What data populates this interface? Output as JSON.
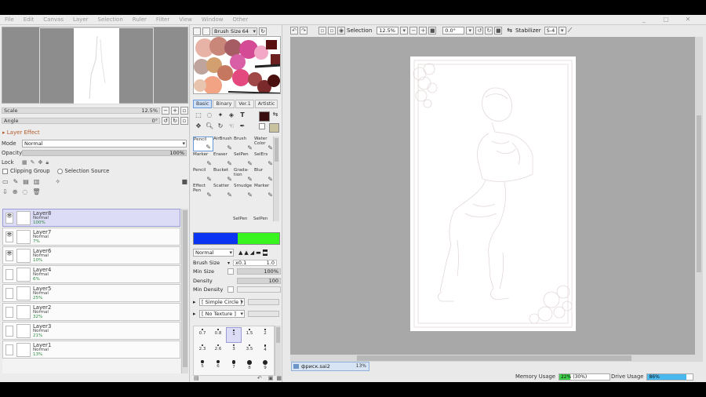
{
  "menu": [
    "File",
    "Edit",
    "Canvas",
    "Layer",
    "Selection",
    "Ruler",
    "Filter",
    "View",
    "Window",
    "Other"
  ],
  "window_controls": [
    "_",
    "▢",
    "✕"
  ],
  "navigator": {
    "scale_label": "Scale",
    "scale_value": "12.5%",
    "angle_label": "Angle",
    "angle_value": "0°"
  },
  "layer_effect": {
    "title": "Layer Effect",
    "mode_label": "Mode",
    "mode_value": "Normal",
    "opacity_label": "Opacity",
    "opacity_value": "100%",
    "lock_label": "Lock",
    "clipping_label": "Clipping Group",
    "selection_source_label": "Selection Source"
  },
  "layers": [
    {
      "name": "Layer8",
      "mode": "Normal",
      "opacity": "100%",
      "visible": true,
      "selected": true
    },
    {
      "name": "Layer7",
      "mode": "Normal",
      "opacity": "7%",
      "visible": true,
      "selected": false
    },
    {
      "name": "Layer6",
      "mode": "Normal",
      "opacity": "10%",
      "visible": true,
      "selected": false
    },
    {
      "name": "Layer4",
      "mode": "Normal",
      "opacity": "6%",
      "visible": false,
      "selected": false
    },
    {
      "name": "Layer5",
      "mode": "Normal",
      "opacity": "25%",
      "visible": false,
      "selected": false
    },
    {
      "name": "Layer2",
      "mode": "Normal",
      "opacity": "32%",
      "visible": false,
      "selected": false
    },
    {
      "name": "Layer3",
      "mode": "Normal",
      "opacity": "21%",
      "visible": false,
      "selected": false
    },
    {
      "name": "Layer1",
      "mode": "Normal",
      "opacity": "13%",
      "visible": false,
      "selected": false
    }
  ],
  "brush_panel": {
    "brush_size_label": "Brush Size",
    "brush_size_value": "64",
    "tabs": [
      "Basic",
      "Binary",
      "Ver.1",
      "Artistic"
    ],
    "active_tab": "Basic",
    "tool_icons": [
      "select-rect-icon",
      "lasso-icon",
      "magic-wand-icon",
      "move-icon",
      "text-tool-icon",
      "zoom-icon",
      "rotate-icon",
      "hand-icon",
      "eyedropper-icon"
    ],
    "primary_color": "#3a0f0f",
    "secondary_color": "#c8c39e",
    "brushes": [
      {
        "label": "Pencil",
        "selected": true
      },
      {
        "label": "AirBrush",
        "selected": false
      },
      {
        "label": "Brush",
        "selected": false
      },
      {
        "label": "Water Color",
        "selected": false
      },
      {
        "label": "Marker",
        "selected": false
      },
      {
        "label": "Eraser",
        "selected": false
      },
      {
        "label": "SelPen",
        "selected": false
      },
      {
        "label": "SelErs",
        "selected": false
      },
      {
        "label": "Pencil",
        "selected": false
      },
      {
        "label": "Bucket",
        "selected": false
      },
      {
        "label": "Grada- tion",
        "selected": false
      },
      {
        "label": "Blur",
        "selected": false
      },
      {
        "label": "Effect Pen",
        "selected": false
      },
      {
        "label": "Scatter",
        "selected": false
      },
      {
        "label": "Smudge",
        "selected": false
      },
      {
        "label": "Marker",
        "selected": false
      }
    ],
    "extra_brushes": [
      "SelPen",
      "SelPen"
    ],
    "blend_mode": "Normal",
    "brush_size_row_label": "Brush Size",
    "brush_size_multiplier": "x0.1",
    "brush_size_row_value": "1.0",
    "min_size_label": "Min Size",
    "min_size_value": "100%",
    "density_label": "Density",
    "density_value": "100",
    "min_density_label": "Min Density",
    "shape_label": "[ Simple Circle ]",
    "texture_label": "[ No Texture ]",
    "size_presets": [
      "0.7",
      "0.8",
      "1",
      "1.5",
      "2",
      "2.3",
      "2.6",
      "3",
      "3.5",
      "4",
      "5",
      "6",
      "7",
      "8",
      "9"
    ],
    "selected_preset": "1"
  },
  "canvas_toolbar": {
    "selection_label": "Selection",
    "zoom_value": "12.5%",
    "angle_value": "0.0°",
    "stabilizer_label": "Stabilizer",
    "stabilizer_value": "S-4"
  },
  "document": {
    "filename": "фриск.sai2",
    "zoom": "13%"
  },
  "status": {
    "memory_label": "Memory Usage",
    "memory_value": "22% (30%)",
    "memory_fraction": 0.22,
    "drive_label": "Drive Usage",
    "drive_value": "86%",
    "drive_fraction": 0.86
  },
  "colors": {
    "layer_selected": "#dcdcf6",
    "opacity_green": "#2b8a3e",
    "memory_fill": "#3fcf4a",
    "drive_fill": "#49b8ef",
    "accent": "#6a9ad6"
  }
}
